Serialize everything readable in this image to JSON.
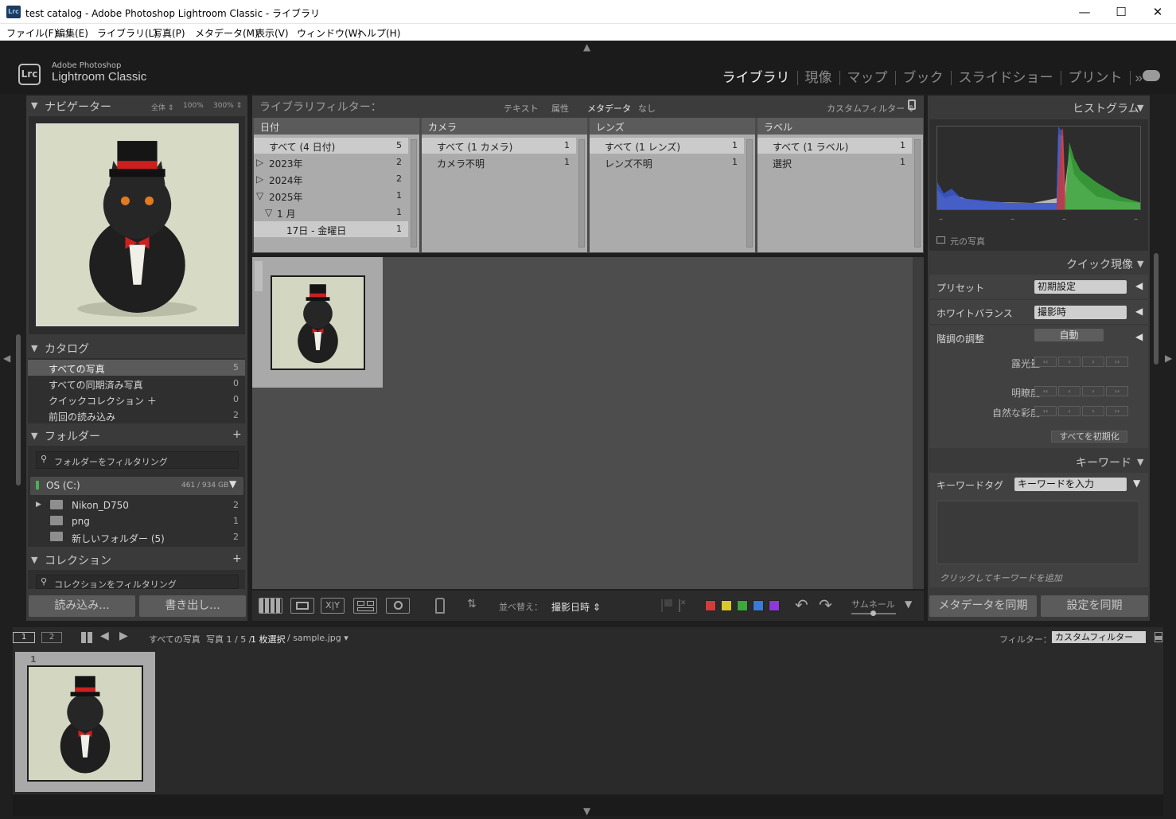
{
  "window": {
    "title": "test catalog - Adobe Photoshop Lightroom Classic - ライブラリ",
    "icon": "Lrc",
    "controls": [
      "—",
      "☐",
      "✕"
    ]
  },
  "menu": [
    "ファイル(F)",
    "編集(E)",
    "ライブラリ(L)",
    "写真(P)",
    "メタデータ(M)",
    "表示(V)",
    "ウィンドウ(W)",
    "ヘルプ(H)"
  ],
  "identity": {
    "logo": "Lrc",
    "line1": "Adobe Photoshop",
    "line2": "Lightroom Classic"
  },
  "modules": [
    "ライブラリ",
    "現像",
    "マップ",
    "ブック",
    "スライドショー",
    "プリント"
  ],
  "modules_more": "»",
  "navigator": {
    "title": "ナビゲーター",
    "zooms": [
      "全体 ⇕",
      "100%",
      "300% ⇕"
    ]
  },
  "catalog": {
    "title": "カタログ",
    "items": [
      {
        "label": "すべての写真",
        "count": "5"
      },
      {
        "label": "すべての同期済み写真",
        "count": "0"
      },
      {
        "label": "クイックコレクション ＋",
        "count": "0"
      },
      {
        "label": "前回の読み込み",
        "count": "2"
      }
    ]
  },
  "folders": {
    "title": "フォルダー",
    "search_placeholder": "フォルダーをフィルタリング",
    "volume": "OS (C:)",
    "volume_size": "461 / 934 GB",
    "items": [
      {
        "label": "Nikon_D750",
        "count": "2"
      },
      {
        "label": "png",
        "count": "1"
      },
      {
        "label": "新しいフォルダー (5)",
        "count": "2"
      }
    ]
  },
  "collections": {
    "title": "コレクション",
    "search_placeholder": "コレクションをフィルタリング"
  },
  "left_buttons": {
    "import": "読み込み...",
    "export": "書き出し..."
  },
  "filter_bar": {
    "title": "ライブラリフィルター：",
    "tabs": [
      "テキスト",
      "属性",
      "メタデータ",
      "なし"
    ],
    "preset": "カスタムフィルター ⇕"
  },
  "metadata_columns": [
    {
      "header": "日付",
      "rows": [
        {
          "label": "すべて (4 日付)",
          "count": "5"
        },
        {
          "label": "2023年",
          "count": "2",
          "arrow": "▷"
        },
        {
          "label": "2024年",
          "count": "2",
          "arrow": "▷"
        },
        {
          "label": "2025年",
          "count": "1",
          "arrow": "▽"
        },
        {
          "label": "1 月",
          "count": "1",
          "arrow": "▽"
        },
        {
          "label": "17日 - 金曜日",
          "count": "1"
        }
      ]
    },
    {
      "header": "カメラ",
      "rows": [
        {
          "label": "すべて (1 カメラ)",
          "count": "1"
        },
        {
          "label": "カメラ不明",
          "count": "1"
        }
      ]
    },
    {
      "header": "レンズ",
      "rows": [
        {
          "label": "すべて (1 レンズ)",
          "count": "1"
        },
        {
          "label": "レンズ不明",
          "count": "1"
        }
      ]
    },
    {
      "header": "ラベル",
      "rows": [
        {
          "label": "すべて (1 ラベル)",
          "count": "1"
        },
        {
          "label": "選択",
          "count": "1"
        }
      ]
    }
  ],
  "toolbar": {
    "loupe_xy": "X|Y",
    "sort_label": "並べ替え：",
    "sort_value": "撮影日時 ⇕",
    "thumb_label": "サムネール",
    "color_labels": [
      "#d63a3a",
      "#d8c82a",
      "#3aa83a",
      "#3a7ad8",
      "#8a3ad8"
    ]
  },
  "histogram": {
    "title": "ヒストグラム",
    "original_photo": "元の写真",
    "ticks": [
      "–",
      "–",
      "–",
      "–"
    ]
  },
  "quick_develop": {
    "title": "クイック現像",
    "preset_label": "プリセット",
    "preset_value": "初期設定",
    "wb_label": "ホワイトバランス",
    "wb_value": "撮影時",
    "tone_label": "階調の調整",
    "auto": "自動",
    "exposure": "露光量",
    "clarity": "明瞭度",
    "vibrance": "自然な彩度",
    "reset_all": "すべてを初期化",
    "stepper": [
      "‹‹",
      "‹",
      "›",
      "››"
    ]
  },
  "keywords": {
    "title": "キーワード",
    "tag_label": "キーワードタグ",
    "tag_value": "キーワードを入力",
    "add_hint": "クリックしてキーワードを追加"
  },
  "right_buttons": {
    "sync_metadata": "メタデータを同期",
    "sync_settings": "設定を同期"
  },
  "filmstrip": {
    "screen1": "1",
    "screen2": "2",
    "source": "すべての写真",
    "count_prefix": "写真 1 / 5 /",
    "selected": "1 枚選択",
    "file": "/ sample.jpg ▾",
    "filter_label": "フィルター：",
    "filter_value": "カスタムフィルター",
    "cell_index": "1"
  }
}
